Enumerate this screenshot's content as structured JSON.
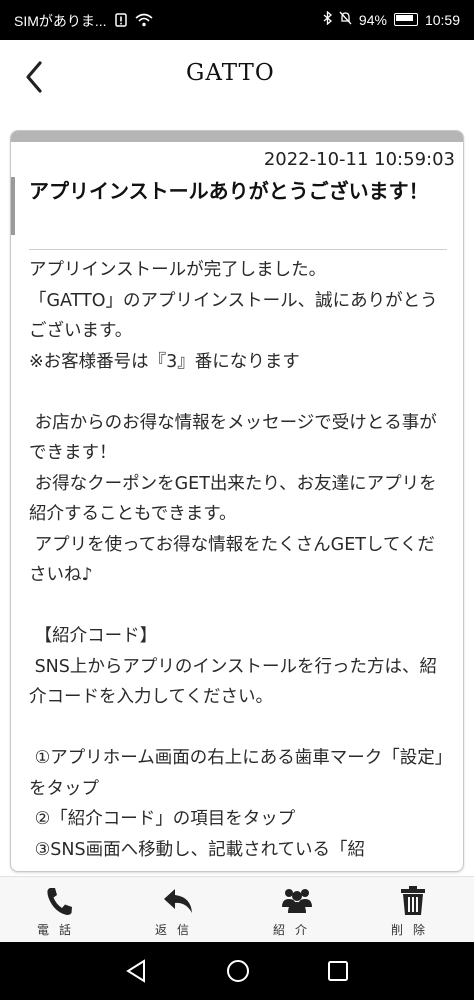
{
  "status_bar": {
    "carrier": "SIMがありま...",
    "battery_percent": "94%",
    "time": "10:59"
  },
  "app": {
    "logo_text": "GATTO"
  },
  "message": {
    "timestamp": "2022-10-11 10:59:03",
    "title": "アプリインストールありがとうございます！",
    "body": "アプリインストールが完了しました。\n「GATTO」のアプリインストール、誠にありがとうございます。\n※お客様番号は『3』番になります\n\n お店からのお得な情報をメッセージで受けとる事ができます！\n お得なクーポンをGET出来たり、お友達にアプリを紹介することもできます。\n アプリを使ってお得な情報をたくさんGETしてくださいね♪\n\n 【紹介コード】\n SNS上からアプリのインストールを行った方は、紹介コードを入力してください。\n\n ①アプリホーム画面の右上にある歯車マーク「設定」をタップ\n ②「紹介コード」の項目をタップ\n ③SNS画面へ移動し、記載されている「紹"
  },
  "bottom_tabs": [
    {
      "label": "電話",
      "icon": "phone-icon"
    },
    {
      "label": "返信",
      "icon": "reply-icon"
    },
    {
      "label": "紹介",
      "icon": "people-icon"
    },
    {
      "label": "削除",
      "icon": "trash-icon"
    }
  ],
  "nav_bar": {
    "buttons": [
      "back-triangle-icon",
      "home-circle-icon",
      "recents-square-icon"
    ]
  }
}
